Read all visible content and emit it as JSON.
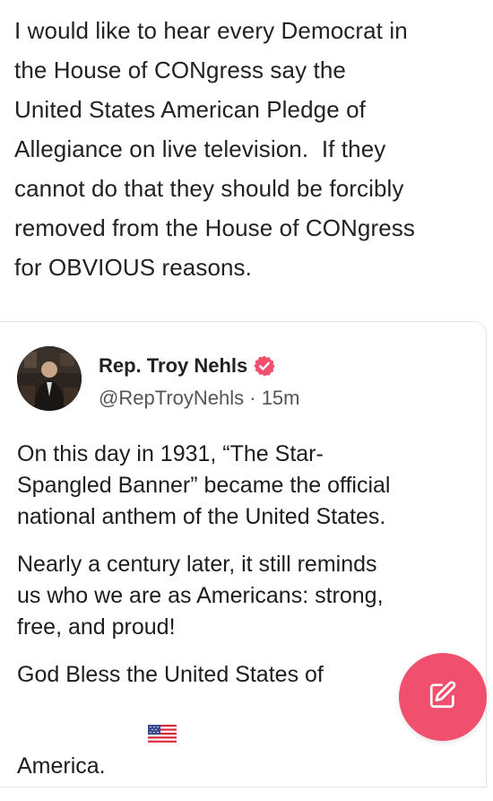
{
  "post": {
    "text": "I would like to hear every Democrat in\nthe House of CONgress say the\nUnited States American Pledge of\nAllegiance on live television.  If they\ncannot do that they should be forcibly\nremoved from the House of CONgress\nfor OBVIOUS reasons."
  },
  "quoted": {
    "author_name": "Rep. Troy Nehls",
    "handle": "@RepTroyNehls",
    "time_sep": " · ",
    "time": "15m",
    "paragraphs": [
      "On this day in 1931, “The Star-\nSpangled Banner” became the official\nnational anthem of the United States.",
      "Nearly a century later, it still reminds\nus who we are as Americans: strong,\nfree, and proud!",
      "God Bless the United States of\nAmerica."
    ]
  },
  "icons": {
    "verified": "verified-badge-icon",
    "compose": "pencil-icon",
    "flag": "us-flag-icon"
  },
  "colors": {
    "accent": "#f0506e",
    "verified": "#f0506e"
  }
}
